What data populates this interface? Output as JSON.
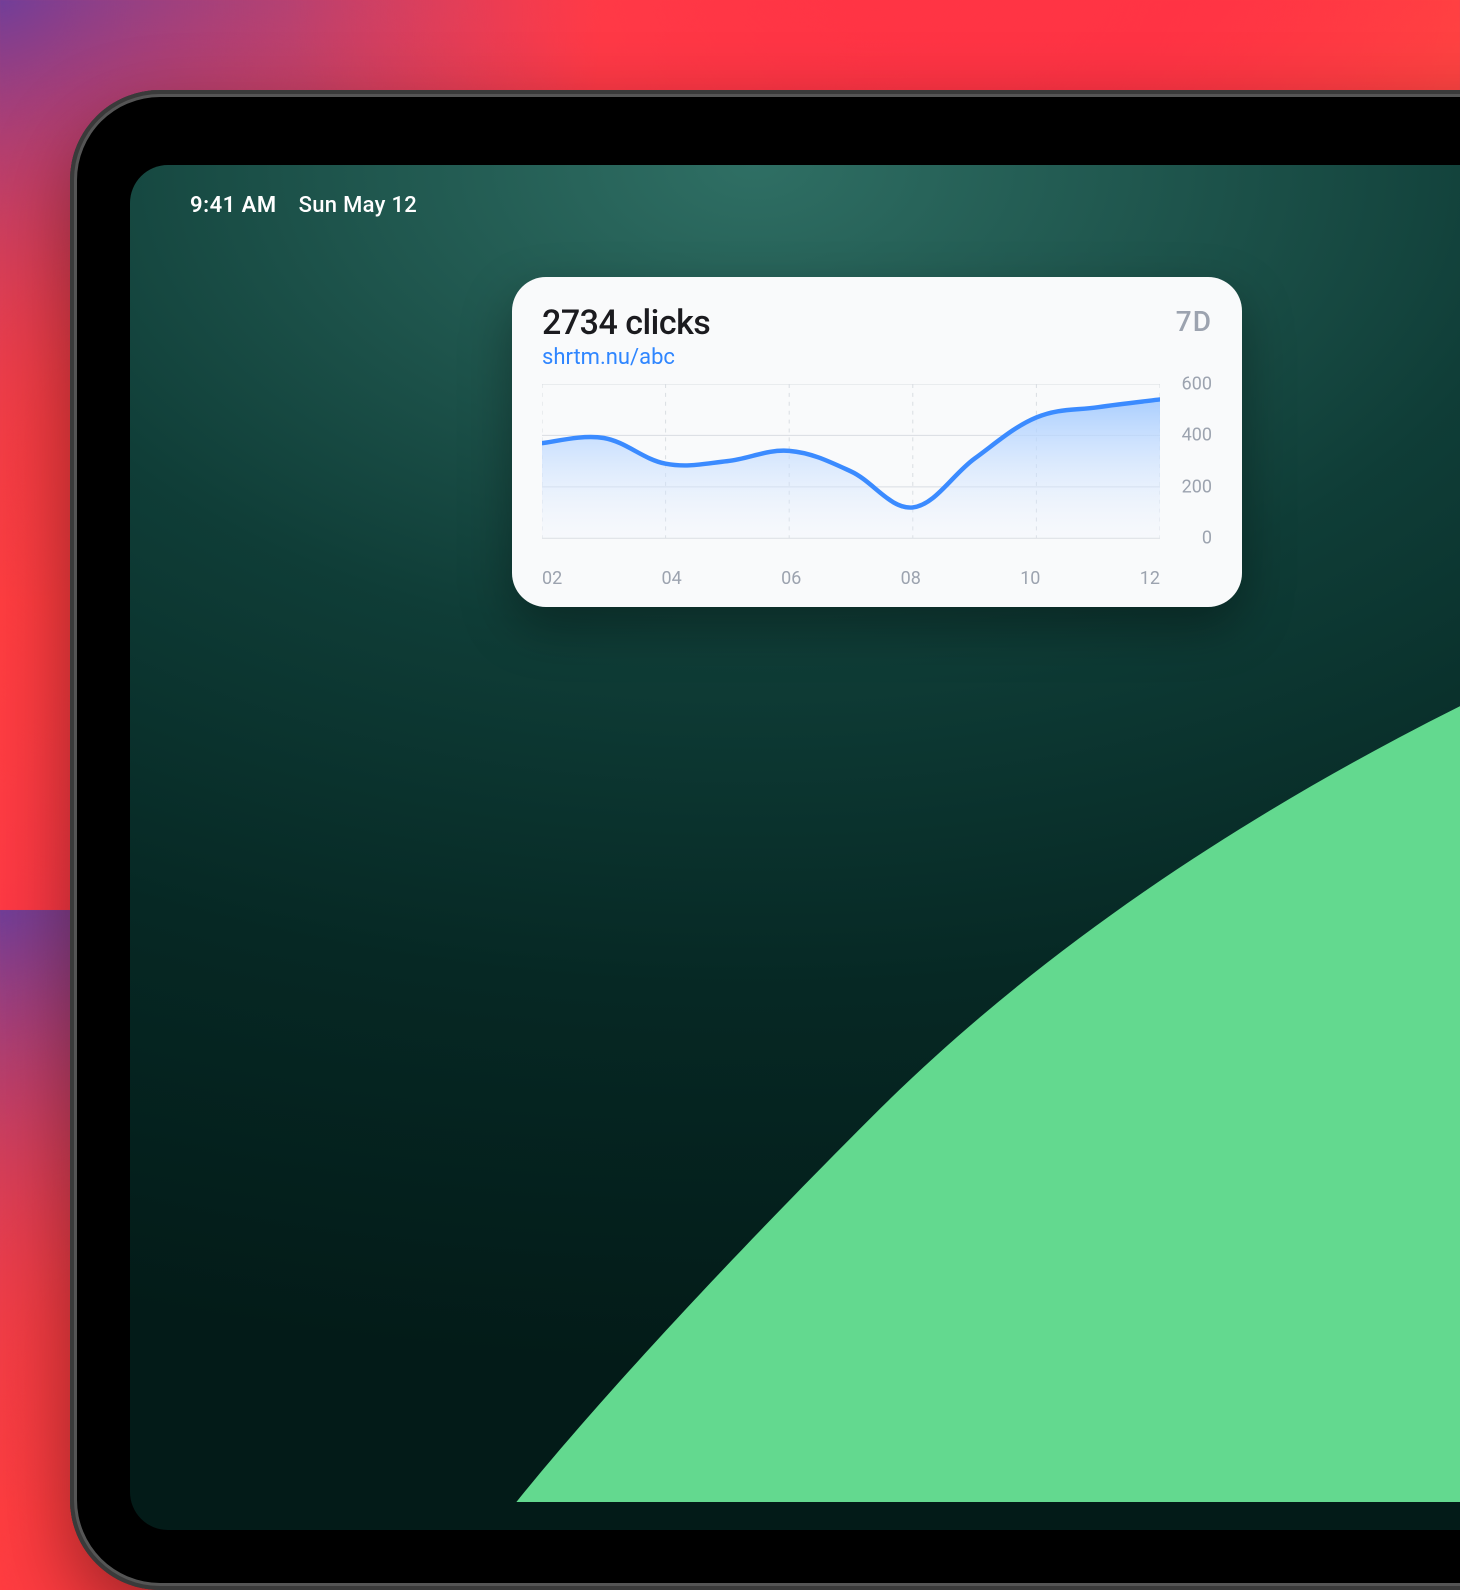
{
  "statusbar": {
    "time": "9:41 AM",
    "date": "Sun May 12"
  },
  "widget": {
    "title": "2734 clicks",
    "link_label": "shrtm.nu/abc",
    "range_label": "7D"
  },
  "chart_data": {
    "type": "area",
    "title": "2734 clicks",
    "xlabel": "",
    "ylabel": "",
    "ylim": [
      0,
      600
    ],
    "x_ticks": [
      "02",
      "04",
      "06",
      "08",
      "10",
      "12"
    ],
    "y_ticks": [
      0,
      200,
      400,
      600
    ],
    "x": [
      2,
      3,
      4,
      5,
      6,
      7,
      8,
      9,
      10,
      11,
      12
    ],
    "values": [
      370,
      390,
      290,
      300,
      340,
      260,
      120,
      310,
      470,
      510,
      540
    ],
    "colors": {
      "line": "#3b8bff",
      "area_top": "#a6ccff",
      "area_bottom": "#eaf2ff",
      "grid": "#d9dde2"
    }
  }
}
